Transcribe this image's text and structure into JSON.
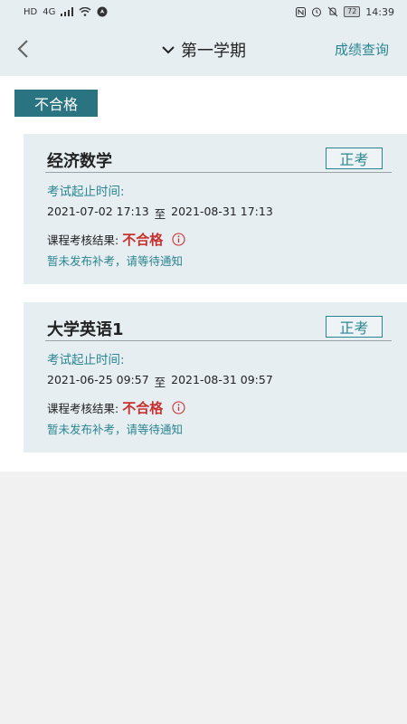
{
  "status_bar": {
    "left_icons": [
      "HD",
      "4G",
      "signal-icon",
      "wifi-icon",
      "nav-icon"
    ],
    "battery": "72",
    "time": "14:39"
  },
  "header": {
    "title": "第一学期",
    "right_link": "成绩查询"
  },
  "filter": {
    "label": "不合格"
  },
  "courses": [
    {
      "name": "经济数学",
      "badge": "正考",
      "time_label": "考试起止时间:",
      "start": "2021-07-02  17:13",
      "sep": "至",
      "end": "2021-08-31  17:13",
      "result_label": "课程考核结果:",
      "result": "不合格",
      "note": "暂未发布补考，请等待通知"
    },
    {
      "name": "大学英语1",
      "badge": "正考",
      "time_label": "考试起止时间:",
      "start": "2021-06-25  09:57",
      "sep": "至",
      "end": "2021-08-31  09:57",
      "result_label": "课程考核结果:",
      "result": "不合格",
      "note": "暂未发布补考，请等待通知"
    }
  ],
  "colors": {
    "accent": "#2b8590",
    "tag_bg": "#2a7482",
    "fail": "#c8312f",
    "card_bg": "#e6eef1"
  }
}
